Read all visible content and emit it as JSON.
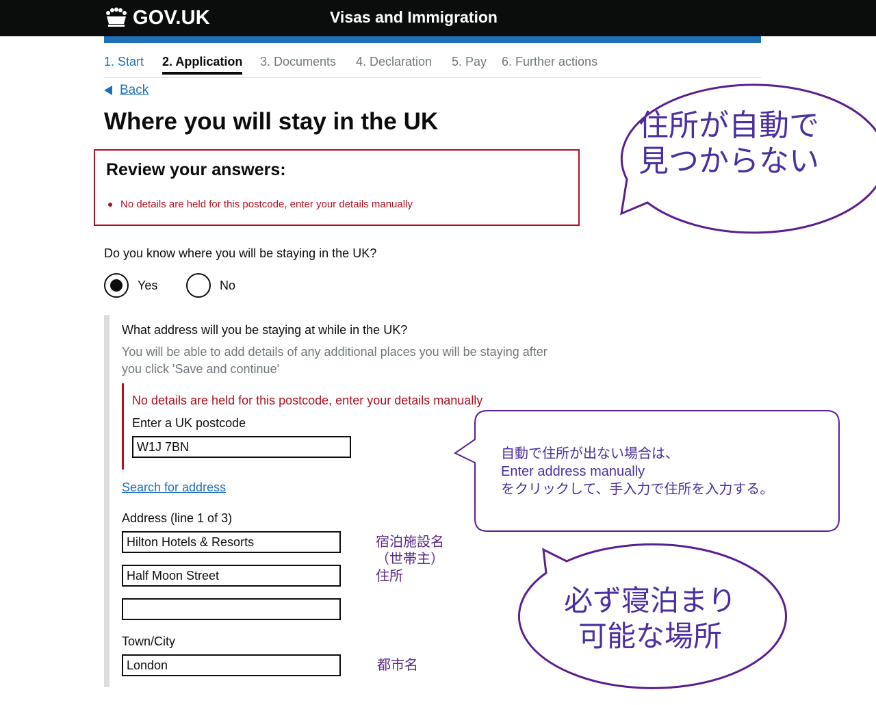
{
  "header": {
    "logo_text": "GOV.UK",
    "service_name": "Visas and Immigration"
  },
  "steps": [
    {
      "label": "1. Start",
      "state": "link"
    },
    {
      "label": "2. Application",
      "state": "current"
    },
    {
      "label": "3. Documents",
      "state": "inactive"
    },
    {
      "label": "4. Declaration",
      "state": "inactive"
    },
    {
      "label": "5. Pay",
      "state": "inactive"
    },
    {
      "label": "6. Further actions",
      "state": "inactive"
    }
  ],
  "back_link": "Back",
  "page_title": "Where you will stay in the UK",
  "error_summary": {
    "heading": "Review your answers:",
    "items": [
      "No details are held for this postcode, enter your details manually"
    ]
  },
  "stay_question": {
    "label": "Do you know where you will be staying in the UK?",
    "options": [
      {
        "label": "Yes",
        "selected": true
      },
      {
        "label": "No",
        "selected": false
      }
    ]
  },
  "address_section": {
    "question": "What address will you be staying at while in the UK?",
    "hint": "You will be able to add details of any additional places you will be staying after you click 'Save and continue'",
    "postcode_error": "No details are held for this postcode, enter your details manually",
    "postcode_label": "Enter a UK postcode",
    "postcode_value": "W1J 7BN",
    "search_link": "Search for address",
    "address_label": "Address (line 1 of 3)",
    "address_line1": "Hilton Hotels & Resorts",
    "address_line2": "Half Moon Street",
    "address_line3": "",
    "town_label": "Town/City",
    "town_value": "London"
  },
  "annotations": {
    "bubble_top": [
      "住所が自動で",
      "見つからない"
    ],
    "bubble_middle": [
      "自動で住所が出ない場合は、",
      "Enter address manually",
      "をクリックして、手入力で住所を入力する。"
    ],
    "bubble_bottom": [
      "必ず寝泊まり",
      "可能な場所"
    ],
    "note_facility": [
      "宿泊施設名",
      "（世帯主）",
      "住所"
    ],
    "note_city": "都市名"
  },
  "colors": {
    "header_bg": "#0b0c0c",
    "brand_blue": "#1d70b8",
    "error_red": "#b10e1e",
    "annotation_purple": "#5b1e8f"
  }
}
